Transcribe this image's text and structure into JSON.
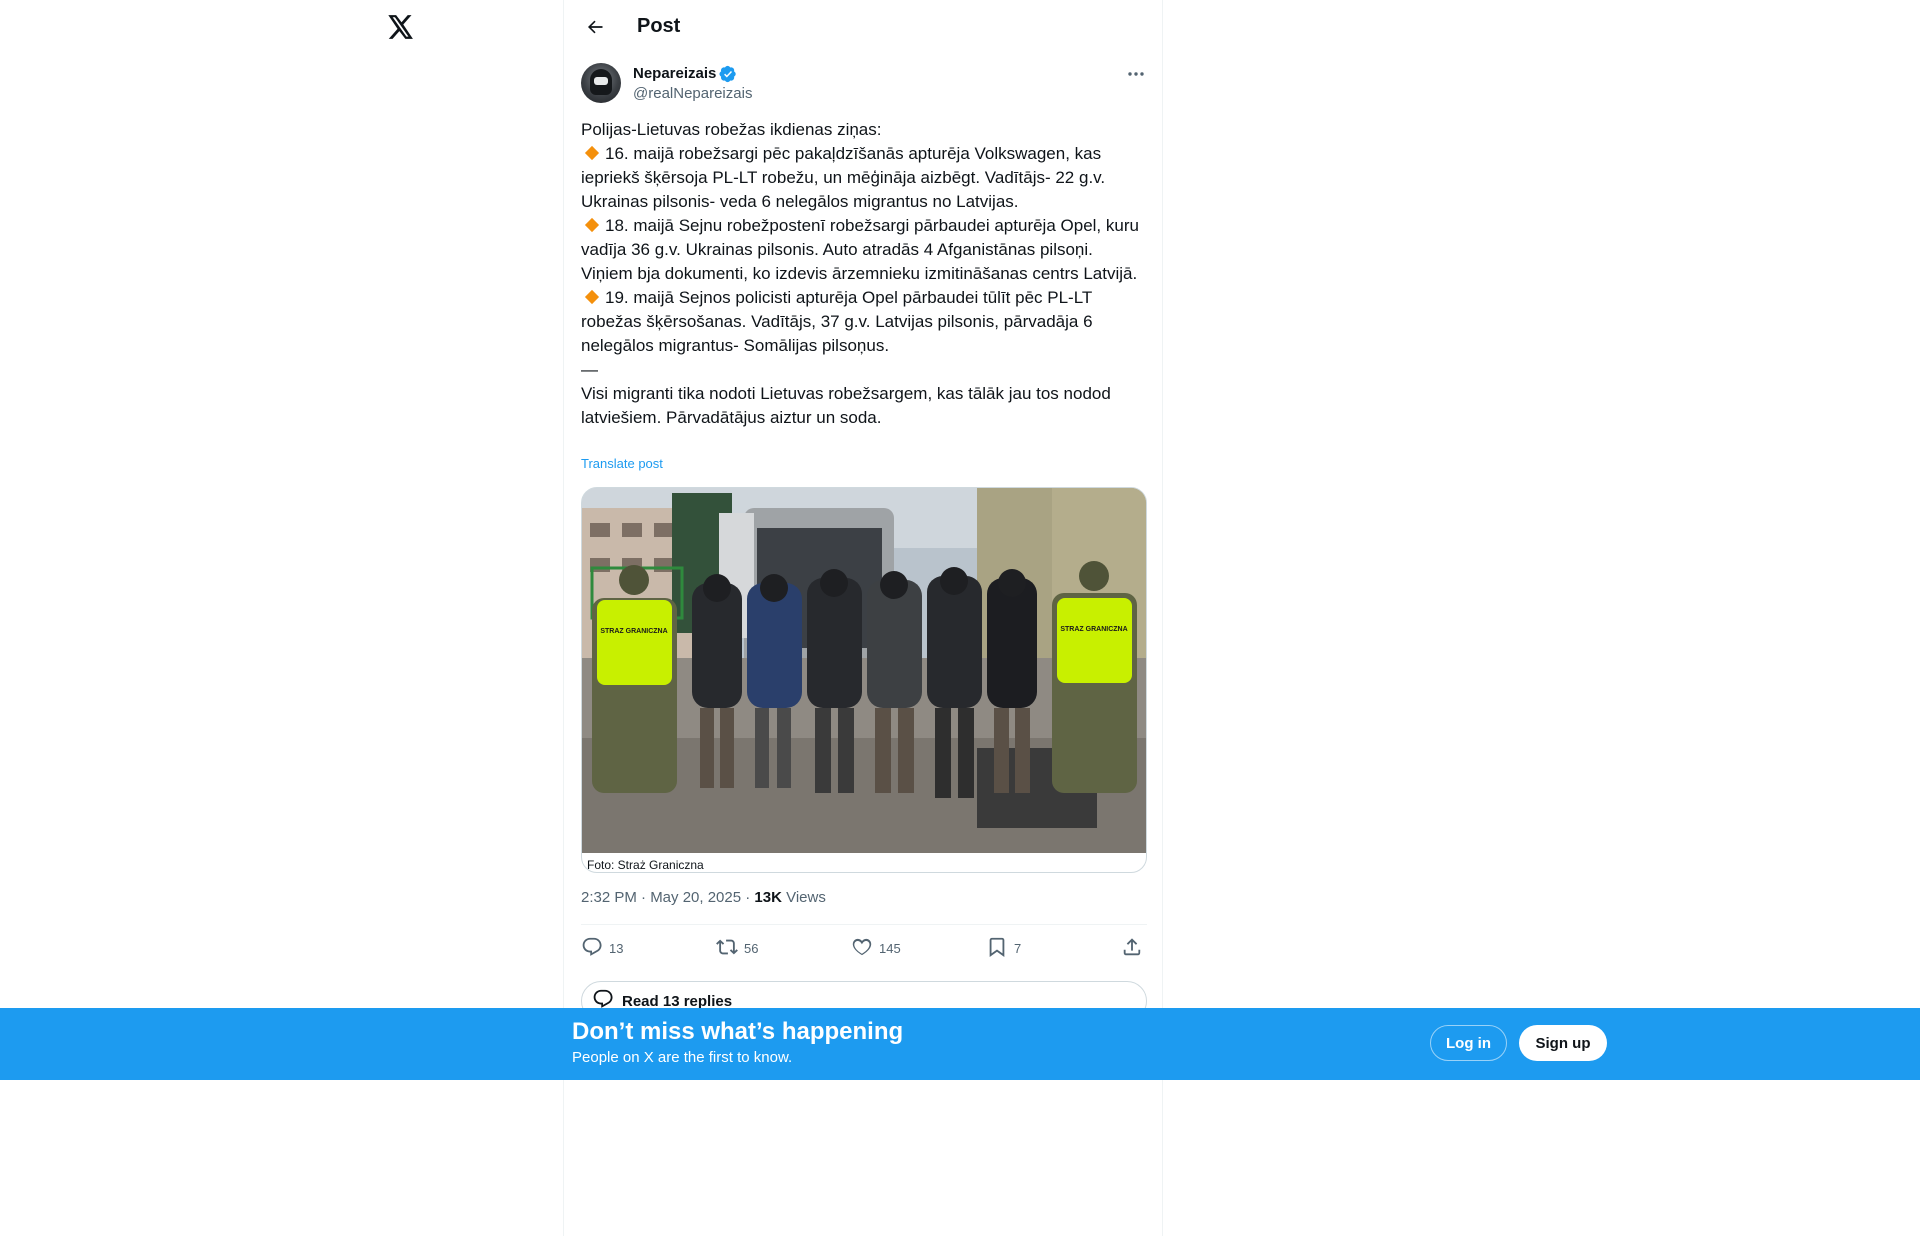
{
  "header": {
    "title": "Post"
  },
  "author": {
    "name": "Nepareizais",
    "handle": "@realNepareizais"
  },
  "tweet": {
    "intro": "Polijas-Lietuvas robežas ikdienas ziņas:",
    "item1": "16. maijā robežsargi pēc pakaļdzīšanās apturēja Volkswagen, kas iepriekš šķērsoja PL-LT robežu, un mēģināja aizbēgt. Vadītājs- 22 g.v. Ukrainas pilsonis- veda 6 nelegālos migrantus no Latvijas.",
    "item2": "18. maijā Sejnu robežpostenī robežsargi pārbaudei apturēja Opel, kuru vadīja 36 g.v. Ukrainas pilsonis. Auto atradās 4 Afganistānas pilsoņi. Viņiem bja dokumenti, ko izdevis ārzemnieku izmitināšanas centrs Latvijā.",
    "item3": "19. maijā Sejnos policisti apturēja Opel pārbaudei tūlīt pēc PL-LT robežas šķērsošanas. Vadītājs, 37 g.v. Latvijas pilsonis, pārvadāja 6 nelegālos migrantus- Somālijas pilsoņus.",
    "separator": "—",
    "outro": "Visi migranti tika nodoti Lietuvas robežsargem, kas tālāk jau tos nodod latviešiem. Pārvadātājus aiztur un soda.",
    "translate_label": "Translate post"
  },
  "media": {
    "caption": "Foto: Straż Graniczna",
    "vest_text": "STRAZ GRANICZNA"
  },
  "meta": {
    "time": "2:32 PM · May 20, 2025 · ",
    "views_count": "13K",
    "views_label": " Views"
  },
  "actions": {
    "replies": "13",
    "reposts": "56",
    "likes": "145",
    "bookmarks": "7"
  },
  "replies_button": {
    "label": "Read 13 replies"
  },
  "banner": {
    "title": "Don’t miss what’s happening",
    "subtitle": "People on X are the first to know.",
    "login_label": "Log in",
    "signup_label": "Sign up"
  },
  "colors": {
    "accent": "#1d9bf0",
    "text": "#0f1419",
    "secondary": "#536471",
    "diamond": "#f4900c",
    "vest": "#c8f000"
  },
  "icons": [
    "x-logo-icon",
    "back-arrow-icon",
    "verified-badge-icon",
    "more-icon",
    "reply-icon",
    "repost-icon",
    "like-icon",
    "bookmark-icon",
    "share-icon",
    "chat-bubble-icon"
  ]
}
